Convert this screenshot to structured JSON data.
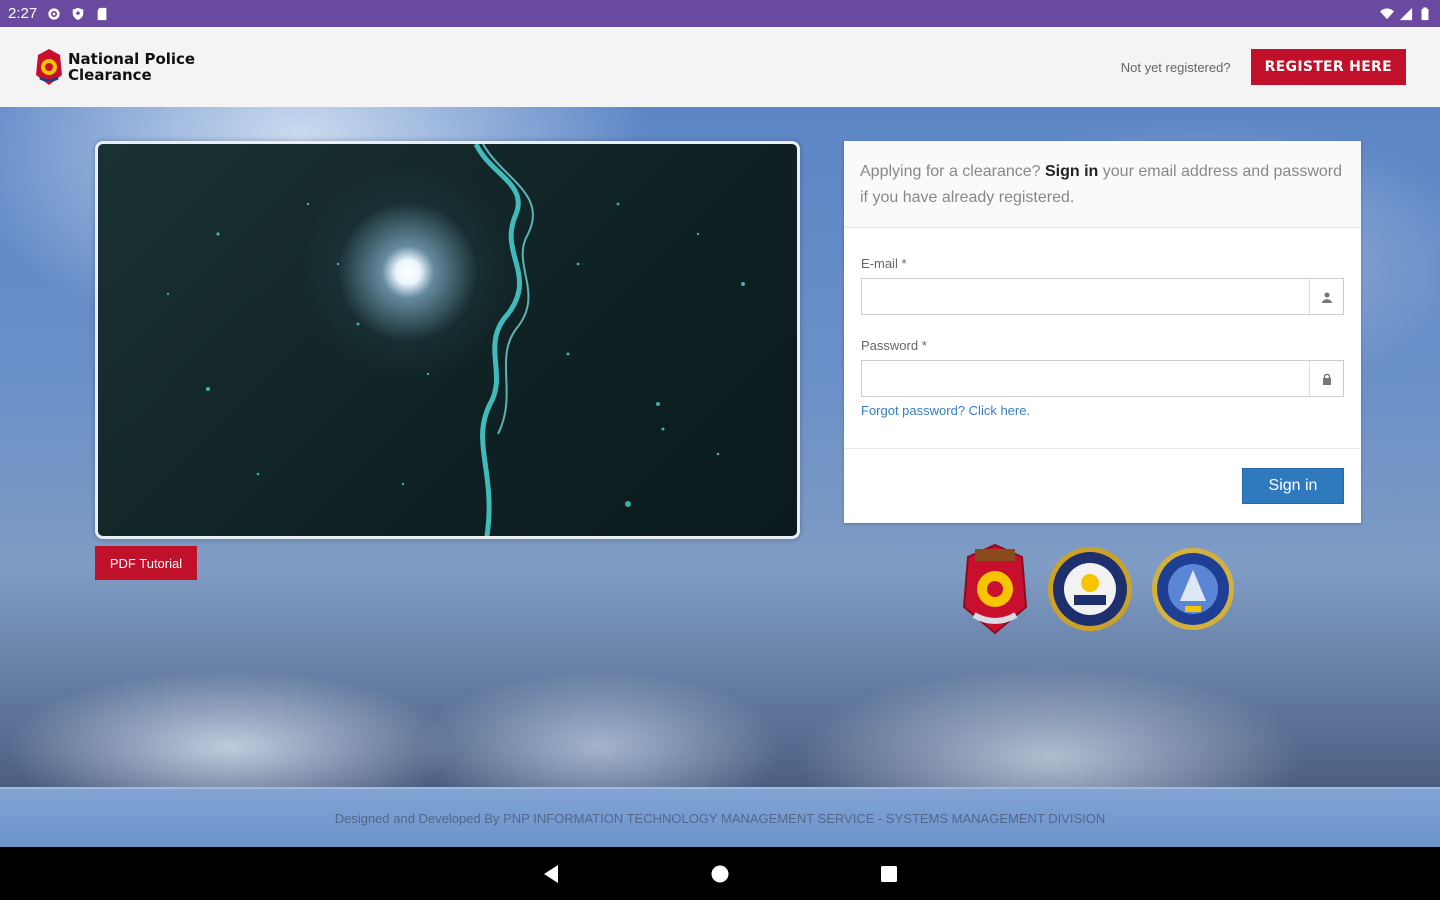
{
  "status_bar": {
    "time": "2:27",
    "left_icons": [
      "settings-icon",
      "shield-icon",
      "sd-card-icon"
    ],
    "right_icons": [
      "wifi-icon",
      "signal-icon",
      "battery-icon"
    ]
  },
  "header": {
    "brand_line1": "National Police",
    "brand_line2": "Clearance",
    "not_registered": "Not yet registered?",
    "register_label": "REGISTER HERE"
  },
  "video": {
    "pdf_tutorial_label": "PDF Tutorial"
  },
  "login": {
    "intro_before": "Applying for a clearance? ",
    "intro_bold": "Sign in",
    "intro_after": " your email address and password if you have already registered.",
    "email_label": "E-mail *",
    "email_value": "",
    "password_label": "Password *",
    "password_value": "",
    "forgot_label": "Forgot password? Click here.",
    "signin_label": "Sign in"
  },
  "seals": [
    "pnp-seal-icon",
    "dilg-seal-icon",
    "napolcom-seal-icon"
  ],
  "footer": {
    "text": "Designed and Developed By PNP INFORMATION TECHNOLOGY MANAGEMENT SERVICE - SYSTEMS MANAGEMENT DIVISION"
  },
  "nav": [
    "back-icon",
    "home-icon",
    "recents-icon"
  ],
  "colors": {
    "status_bar": "#6a4aa0",
    "register": "#c0102a",
    "signin": "#2f79bf",
    "link": "#3a7dc0"
  }
}
